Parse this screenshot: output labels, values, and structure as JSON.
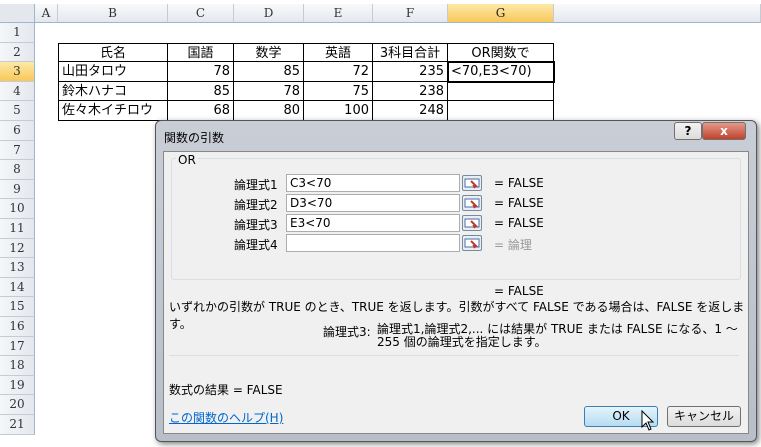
{
  "columns": [
    "A",
    "B",
    "C",
    "D",
    "E",
    "F",
    "G"
  ],
  "rows": [
    "1",
    "2",
    "3",
    "4",
    "5",
    "6",
    "7",
    "8",
    "9",
    "10",
    "11",
    "12",
    "13",
    "14",
    "15",
    "16",
    "17",
    "18",
    "19",
    "20",
    "21"
  ],
  "table": {
    "headers": [
      "氏名",
      "国語",
      "数学",
      "英語",
      "3科目合計",
      "OR関数で"
    ],
    "rows": [
      [
        "山田タロウ",
        "78",
        "85",
        "72",
        "235",
        "<70,E3<70)"
      ],
      [
        "鈴木ハナコ",
        "85",
        "78",
        "75",
        "238",
        ""
      ],
      [
        "佐々木イチロウ",
        "68",
        "80",
        "100",
        "248",
        ""
      ]
    ]
  },
  "dialog": {
    "title": "関数の引数",
    "help_button": "?",
    "close_button": "x",
    "function_name": "OR",
    "args": [
      {
        "label": "論理式1",
        "value": "C3<70",
        "result": "= FALSE"
      },
      {
        "label": "論理式2",
        "value": "D3<70",
        "result": "= FALSE"
      },
      {
        "label": "論理式3",
        "value": "E3<70",
        "result": "= FALSE"
      },
      {
        "label": "論理式4",
        "value": "",
        "result": "= 論理"
      }
    ],
    "overall_result": "= FALSE",
    "description": "いずれかの引数が TRUE のとき、TRUE を返します。引数がすべて FALSE である場合は、FALSE を返します。",
    "arg_help_label": "論理式3:",
    "arg_help_text": "論理式1,論理式2,... には結果が TRUE または FALSE になる、1 〜 255 個の論理式を指定します。",
    "formula_result": "数式の結果 =  FALSE",
    "help_link": "この関数のヘルプ(H)",
    "ok": "OK",
    "cancel": "キャンセル"
  }
}
